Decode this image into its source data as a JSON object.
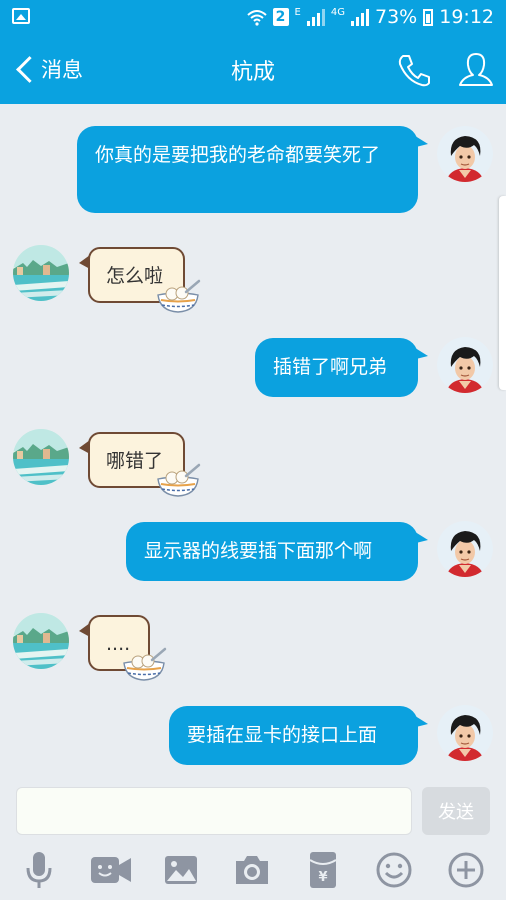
{
  "status_bar": {
    "sim_slot": "2",
    "network_e": "E",
    "network_4g": "4G",
    "battery": "73%",
    "time": "19:12"
  },
  "header": {
    "back_label": "消息",
    "title": "杭成"
  },
  "messages": [
    {
      "direction": "outgoing",
      "text": "你真的是要把我的老命都要笑死了"
    },
    {
      "direction": "incoming",
      "text": "怎么啦"
    },
    {
      "direction": "outgoing",
      "text": "插错了啊兄弟"
    },
    {
      "direction": "incoming",
      "text": "哪错了"
    },
    {
      "direction": "outgoing",
      "text": "显示器的线要插下面那个啊"
    },
    {
      "direction": "incoming",
      "text": "...."
    },
    {
      "direction": "outgoing",
      "text": "要插在显卡的接口上面"
    }
  ],
  "input": {
    "value": "",
    "send_label": "发送"
  },
  "toolbar": [
    "mic-icon",
    "video-icon",
    "image-icon",
    "camera-icon",
    "red-packet-icon",
    "emoji-icon",
    "plus-icon"
  ],
  "colors": {
    "accent": "#0aa2e0",
    "outgoing_bubble": "#0ba1df",
    "incoming_bubble": "#fcf3dd",
    "incoming_border": "#6f4a34",
    "background": "#e9edf1"
  }
}
